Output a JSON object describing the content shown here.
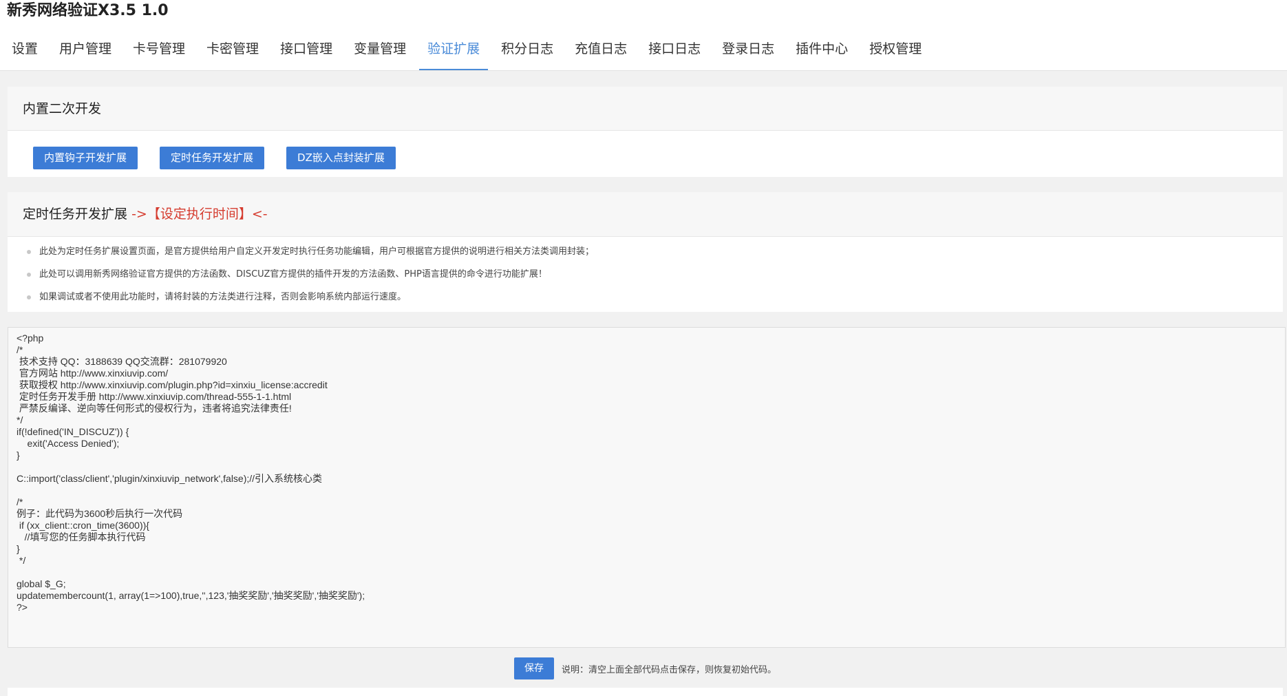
{
  "app": {
    "title": "新秀网络验证X3.5 1.0"
  },
  "nav": {
    "tabs": [
      {
        "label": "设置"
      },
      {
        "label": "用户管理"
      },
      {
        "label": "卡号管理"
      },
      {
        "label": "卡密管理"
      },
      {
        "label": "接口管理"
      },
      {
        "label": "变量管理"
      },
      {
        "label": "验证扩展",
        "active": true
      },
      {
        "label": "积分日志"
      },
      {
        "label": "充值日志"
      },
      {
        "label": "接口日志"
      },
      {
        "label": "登录日志"
      },
      {
        "label": "插件中心"
      },
      {
        "label": "授权管理"
      }
    ]
  },
  "builtin": {
    "title": "内置二次开发",
    "buttons": [
      {
        "label": "内置钩子开发扩展"
      },
      {
        "label": "定时任务开发扩展"
      },
      {
        "label": "DZ嵌入点封装扩展"
      }
    ]
  },
  "cron": {
    "title": "定时任务开发扩展",
    "highlight": "->【设定执行时间】<-",
    "notes": [
      "此处为定时任务扩展设置页面，是官方提供给用户自定义开发定时执行任务功能编辑，用户可根据官方提供的说明进行相关方法类调用封装；",
      "此处可以调用新秀网络验证官方提供的方法函数、DISCUZ官方提供的插件开发的方法函数、PHP语言提供的命令进行功能扩展！",
      "如果调试或者不使用此功能时，请将封装的方法类进行注释，否则会影响系统内部运行速度。"
    ],
    "code": "<?php\n/*\n 技术支持 QQ：3188639 QQ交流群：281079920\n 官方网站 http://www.xinxiuvip.com/\n 获取授权 http://www.xinxiuvip.com/plugin.php?id=xinxiu_license:accredit\n 定时任务开发手册 http://www.xinxiuvip.com/thread-555-1-1.html\n 严禁反编译、逆向等任何形式的侵权行为，违者将追究法律责任!\n*/\nif(!defined('IN_DISCUZ')) {\n    exit('Access Denied');\n}\n\nC::import('class/client','plugin/xinxiuvip_network',false);//引入系统核心类\n\n/*\n例子：此代码为3600秒后执行一次代码\n if (xx_client::cron_time(3600)){\n   //填写您的任务脚本执行代码\n}\n */\n\nglobal $_G;\nupdatemembercount(1, array(1=>100),true,'',123,'抽奖奖励','抽奖奖励','抽奖奖励');\n?>"
  },
  "footer": {
    "save_label": "保存",
    "note": "说明：清空上面全部代码点击保存，则恢复初始代码。"
  }
}
